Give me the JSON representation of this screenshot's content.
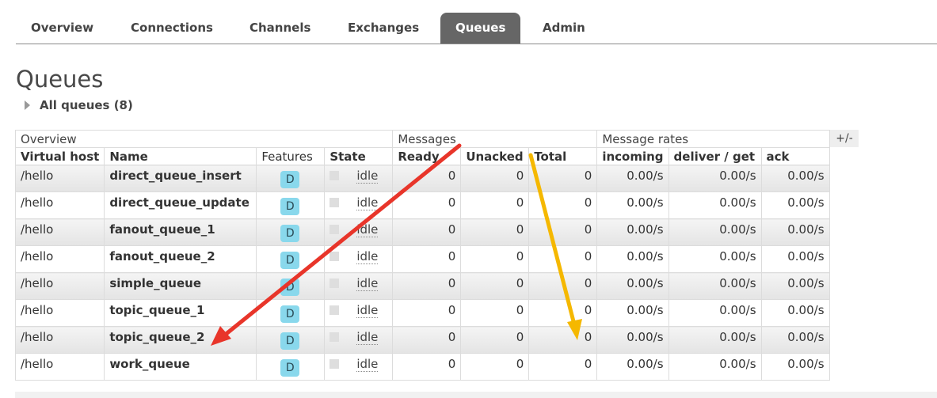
{
  "nav": {
    "tabs": [
      {
        "label": "Overview"
      },
      {
        "label": "Connections"
      },
      {
        "label": "Channels"
      },
      {
        "label": "Exchanges"
      },
      {
        "label": "Queues",
        "active": true
      },
      {
        "label": "Admin"
      }
    ]
  },
  "page": {
    "title": "Queues",
    "section_label": "All queues (8)"
  },
  "table": {
    "groups": {
      "overview": "Overview",
      "messages": "Messages",
      "rates": "Message rates"
    },
    "columns": [
      "Virtual host",
      "Name",
      "Features",
      "State",
      "Ready",
      "Unacked",
      "Total",
      "incoming",
      "deliver / get",
      "ack"
    ],
    "column_toggle": "+/-",
    "rows": [
      {
        "vhost": "/hello",
        "name": "direct_queue_insert",
        "feature": "D",
        "state": "idle",
        "ready": "0",
        "unacked": "0",
        "total": "0",
        "incoming": "0.00/s",
        "deliver": "0.00/s",
        "ack": "0.00/s"
      },
      {
        "vhost": "/hello",
        "name": "direct_queue_update",
        "feature": "D",
        "state": "idle",
        "ready": "0",
        "unacked": "0",
        "total": "0",
        "incoming": "0.00/s",
        "deliver": "0.00/s",
        "ack": "0.00/s"
      },
      {
        "vhost": "/hello",
        "name": "fanout_queue_1",
        "feature": "D",
        "state": "idle",
        "ready": "0",
        "unacked": "0",
        "total": "0",
        "incoming": "0.00/s",
        "deliver": "0.00/s",
        "ack": "0.00/s"
      },
      {
        "vhost": "/hello",
        "name": "fanout_queue_2",
        "feature": "D",
        "state": "idle",
        "ready": "0",
        "unacked": "0",
        "total": "0",
        "incoming": "0.00/s",
        "deliver": "0.00/s",
        "ack": "0.00/s"
      },
      {
        "vhost": "/hello",
        "name": "simple_queue",
        "feature": "D",
        "state": "idle",
        "ready": "0",
        "unacked": "0",
        "total": "0",
        "incoming": "0.00/s",
        "deliver": "0.00/s",
        "ack": "0.00/s"
      },
      {
        "vhost": "/hello",
        "name": "topic_queue_1",
        "feature": "D",
        "state": "idle",
        "ready": "0",
        "unacked": "0",
        "total": "0",
        "incoming": "0.00/s",
        "deliver": "0.00/s",
        "ack": "0.00/s"
      },
      {
        "vhost": "/hello",
        "name": "topic_queue_2",
        "feature": "D",
        "state": "idle",
        "ready": "0",
        "unacked": "0",
        "total": "0",
        "incoming": "0.00/s",
        "deliver": "0.00/s",
        "ack": "0.00/s"
      },
      {
        "vhost": "/hello",
        "name": "work_queue",
        "feature": "D",
        "state": "idle",
        "ready": "0",
        "unacked": "0",
        "total": "0",
        "incoming": "0.00/s",
        "deliver": "0.00/s",
        "ack": "0.00/s"
      }
    ]
  },
  "annotations": {
    "red_arrow_color": "#e8352a",
    "yellow_arrow_color": "#f5b800"
  }
}
